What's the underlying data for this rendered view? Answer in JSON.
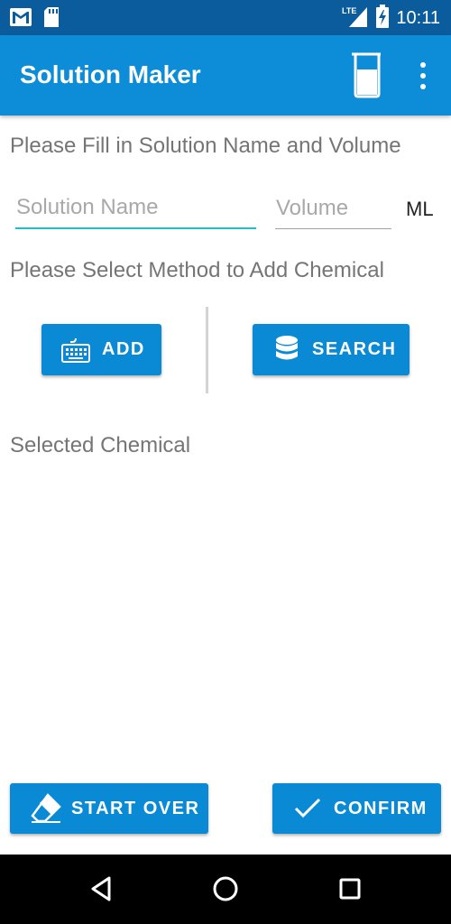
{
  "status_bar": {
    "time": "10:11",
    "network": "LTE",
    "icons": [
      "gmail-icon",
      "sd-card-icon",
      "signal-icon",
      "battery-charging-icon"
    ]
  },
  "app_bar": {
    "title": "Solution Maker",
    "actions": [
      "beaker-icon",
      "overflow-menu-icon"
    ]
  },
  "solution_section": {
    "label": "Please Fill in Solution Name and Volume",
    "name_input": {
      "placeholder": "Solution Name",
      "value": ""
    },
    "volume_input": {
      "placeholder": "Volume",
      "value": ""
    },
    "unit": "ML"
  },
  "method_section": {
    "label": "Please Select Method to Add Chemical",
    "add_label": "ADD",
    "search_label": "SEARCH"
  },
  "selected_section": {
    "label": "Selected Chemical",
    "items": []
  },
  "footer": {
    "start_over_label": "START OVER",
    "confirm_label": "CONFIRM"
  },
  "colors": {
    "status_bar": "#0b5c9c",
    "app_bar": "#0d8cd7",
    "button": "#0a8ad5",
    "input_focus": "#1fbfc7",
    "label_text": "#757575"
  }
}
